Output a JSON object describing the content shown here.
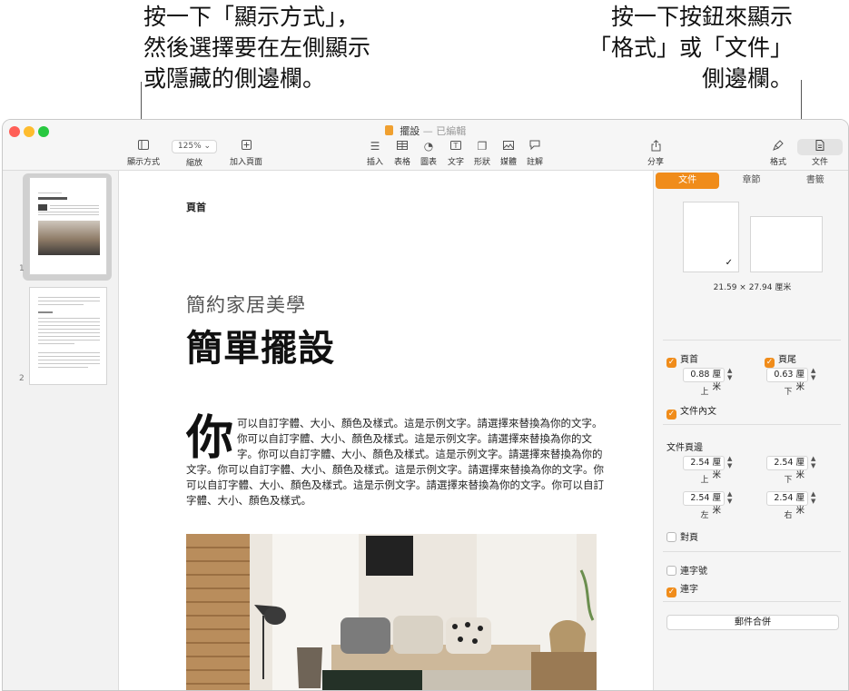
{
  "callouts": {
    "left": [
      "按一下「顯示方式」，",
      "然後選擇要在左側顯示",
      "或隱藏的側邊欄。"
    ],
    "right": [
      "按一下按鈕來顯示",
      "「格式」或「文件」",
      "側邊欄。"
    ]
  },
  "window": {
    "title": "擺設",
    "edited": "— 已編輯"
  },
  "toolbar": {
    "view": "顯示方式",
    "zoom_value": "125%",
    "zoom": "縮放",
    "add_page": "加入頁面",
    "insert": "插入",
    "table": "表格",
    "chart": "圖表",
    "text": "文字",
    "shape": "形狀",
    "media": "媒體",
    "comment": "註解",
    "share": "分享",
    "format": "格式",
    "document": "文件"
  },
  "thumbnails": {
    "page1": "1",
    "page2": "2"
  },
  "document": {
    "header": "頁首",
    "subtitle": "簡約家居美學",
    "title": "簡單擺設",
    "dropcap": "你",
    "body": "可以自訂字體、大小、顏色及樣式。這是示例文字。請選擇來替換為你的文字。你可以自訂字體、大小、顏色及樣式。這是示例文字。請選擇來替換為你的文字。你可以自訂字體、大小、顏色及樣式。這是示例文字。請選擇來替換為你的文字。你可以自訂字體、大小、顏色及樣式。這是示例文字。請選擇來替換為你的文字。你可以自訂字體、大小、顏色及樣式。這是示例文字。請選擇來替換為你的文字。你可以自訂字體、大小、顏色及樣式。"
  },
  "inspector": {
    "tabs": [
      "文件",
      "章節",
      "書籤"
    ],
    "paper_size": "21.59 × 27.94 厘米",
    "header_cb": "頁首",
    "footer_cb": "頁尾",
    "header_value": "0.88 厘米",
    "footer_value": "0.63 厘米",
    "top": "上",
    "bottom": "下",
    "body_cb": "文件內文",
    "margins_head": "文件頁邊",
    "margin_top": "2.54 厘米",
    "margin_bottom": "2.54 厘米",
    "margin_left": "2.54 厘米",
    "margin_right": "2.54 厘米",
    "left": "左",
    "right": "右",
    "facing_cb": "對頁",
    "hyphenation_cb": "連字號",
    "ligatures_cb": "連字",
    "merge_button": "郵件合併"
  },
  "colors": {
    "accent": "#f08c1a",
    "traffic_red": "#ff5f57",
    "traffic_yellow": "#febc2e",
    "traffic_green": "#28c840"
  },
  "icons": {
    "view": "sidebar-icon",
    "zoom": "chevron-down-icon",
    "add_page": "plus-square-icon",
    "insert": "list-icon",
    "table": "table-icon",
    "chart": "clock-chart-icon",
    "text": "textbox-icon",
    "shape": "shapes-icon",
    "media": "photo-icon",
    "comment": "speech-bubble-icon",
    "share": "share-icon",
    "format": "paintbrush-icon",
    "document": "document-icon"
  }
}
